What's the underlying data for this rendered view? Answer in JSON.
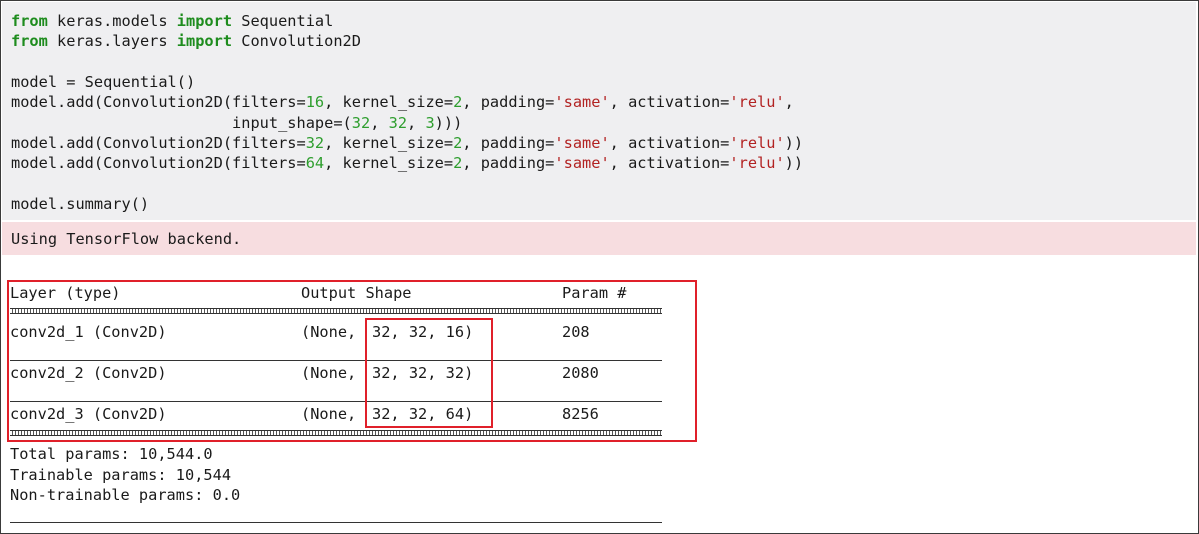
{
  "code_cell": {
    "lines": [
      [
        {
          "t": "from",
          "c": "kw"
        },
        {
          "t": " keras.models "
        },
        {
          "t": "import",
          "c": "kw"
        },
        {
          "t": " Sequential"
        }
      ],
      [
        {
          "t": "from",
          "c": "kw"
        },
        {
          "t": " keras.layers "
        },
        {
          "t": "import",
          "c": "kw"
        },
        {
          "t": " Convolution2D"
        }
      ],
      [],
      [
        {
          "t": "model = Sequential()"
        }
      ],
      [
        {
          "t": "model.add(Convolution2D(filters="
        },
        {
          "t": "16",
          "c": "num"
        },
        {
          "t": ", kernel_size="
        },
        {
          "t": "2",
          "c": "num"
        },
        {
          "t": ", padding="
        },
        {
          "t": "'same'",
          "c": "str"
        },
        {
          "t": ", activation="
        },
        {
          "t": "'relu'",
          "c": "str"
        },
        {
          "t": ","
        }
      ],
      [
        {
          "t": "                        input_shape=("
        },
        {
          "t": "32",
          "c": "num"
        },
        {
          "t": ", "
        },
        {
          "t": "32",
          "c": "num"
        },
        {
          "t": ", "
        },
        {
          "t": "3",
          "c": "num"
        },
        {
          "t": ")))"
        }
      ],
      [
        {
          "t": "model.add(Convolution2D(filters="
        },
        {
          "t": "32",
          "c": "num"
        },
        {
          "t": ", kernel_size="
        },
        {
          "t": "2",
          "c": "num"
        },
        {
          "t": ", padding="
        },
        {
          "t": "'same'",
          "c": "str"
        },
        {
          "t": ", activation="
        },
        {
          "t": "'relu'",
          "c": "str"
        },
        {
          "t": "))"
        }
      ],
      [
        {
          "t": "model.add(Convolution2D(filters="
        },
        {
          "t": "64",
          "c": "num"
        },
        {
          "t": ", kernel_size="
        },
        {
          "t": "2",
          "c": "num"
        },
        {
          "t": ", padding="
        },
        {
          "t": "'same'",
          "c": "str"
        },
        {
          "t": ", activation="
        },
        {
          "t": "'relu'",
          "c": "str"
        },
        {
          "t": "))"
        }
      ],
      [],
      [
        {
          "t": "model.summary()"
        }
      ]
    ]
  },
  "stderr": {
    "text": "Using TensorFlow backend."
  },
  "summary": {
    "headers": {
      "layer": "Layer (type)",
      "output_shape": "Output Shape",
      "params": "Param #"
    },
    "rows": [
      {
        "layer": "conv2d_1 (Conv2D)",
        "shape_prefix": "(None,",
        "shape_dims": "32, 32, 16)",
        "params": "208"
      },
      {
        "layer": "conv2d_2 (Conv2D)",
        "shape_prefix": "(None,",
        "shape_dims": "32, 32, 32)",
        "params": "2080"
      },
      {
        "layer": "conv2d_3 (Conv2D)",
        "shape_prefix": "(None,",
        "shape_dims": "32, 32, 64)",
        "params": "8256"
      }
    ],
    "total_params": "Total params: 10,544.0",
    "trainable_params": "Trainable params: 10,544",
    "non_trainable_params": "Non-trainable params: 0.0"
  },
  "colors": {
    "code_bg": "#efeff1",
    "stderr_bg": "#f7dde0",
    "keyword": "#1e8c1e",
    "number": "#2e9e2e",
    "string": "#b22222",
    "highlight": "#e0202a"
  }
}
